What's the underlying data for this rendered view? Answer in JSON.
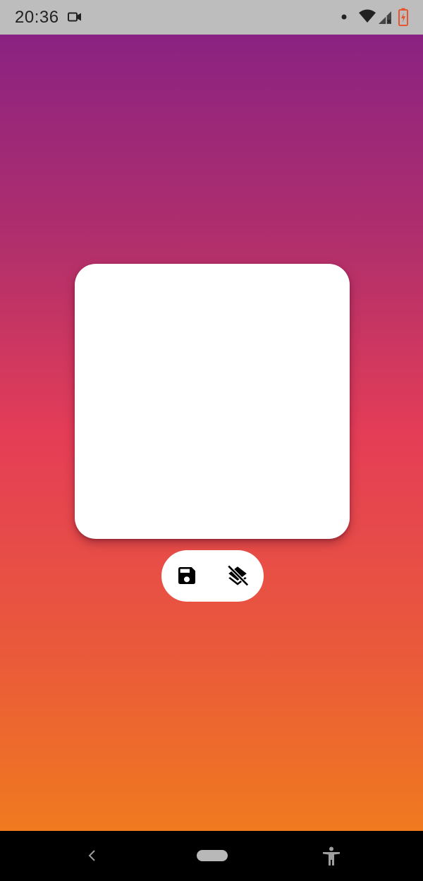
{
  "status_bar": {
    "time": "20:36",
    "icons": [
      "video-camera-icon",
      "notification-dot-icon",
      "wifi-icon",
      "cell-signal-icon",
      "battery-charging-icon"
    ],
    "battery_color": "#e8542e"
  },
  "background_gradient": [
    "#8a2282",
    "#e43d57",
    "#f07a1f"
  ],
  "canvas_card": {
    "color": "#ffffff"
  },
  "toolbar": {
    "buttons": [
      {
        "icon": "save-icon"
      },
      {
        "icon": "layers-clear-icon"
      }
    ]
  },
  "navigation_bar": {
    "buttons": [
      "back-icon",
      "home-pill-icon",
      "accessibility-icon"
    ]
  }
}
